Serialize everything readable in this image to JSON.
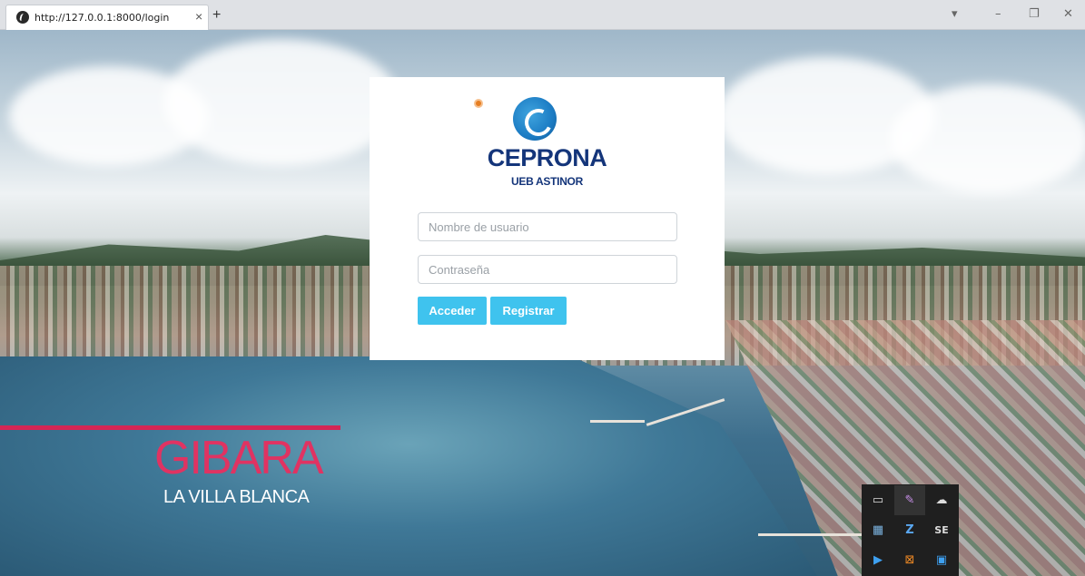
{
  "browser": {
    "tab_title": "http://127.0.0.1:8000/login",
    "tab_close_icon": "×",
    "new_tab_icon": "+",
    "dropdown_icon": "▾",
    "minimize_icon": "–",
    "restore_icon": "❐",
    "close_icon": "✕"
  },
  "login": {
    "brand": "CEPRONA",
    "brand_sub": "UEB ASTINOR",
    "badge": "o",
    "username_placeholder": "Nombre de usuario",
    "password_placeholder": "Contraseña",
    "login_button": "Acceder",
    "register_button": "Registrar",
    "brand_color": "#14357a",
    "button_color": "#3fc3ee"
  },
  "hero": {
    "title": "GIBARA",
    "subtitle": "LA VILLA BLANCA",
    "title_color": "#e03362"
  },
  "tray": {
    "items": [
      {
        "icon": "note-icon",
        "glyph": "▭"
      },
      {
        "icon": "feather-icon",
        "glyph": "✎"
      },
      {
        "icon": "cloud-icon",
        "glyph": "☁"
      },
      {
        "icon": "app-icon",
        "glyph": "▦"
      },
      {
        "icon": "zip-icon",
        "glyph": "Z"
      },
      {
        "icon": "se-icon",
        "glyph": "SE"
      },
      {
        "icon": "play-icon",
        "glyph": "▶"
      },
      {
        "icon": "xampp-icon",
        "glyph": "⊠"
      },
      {
        "icon": "save-icon",
        "glyph": "▣"
      }
    ]
  }
}
